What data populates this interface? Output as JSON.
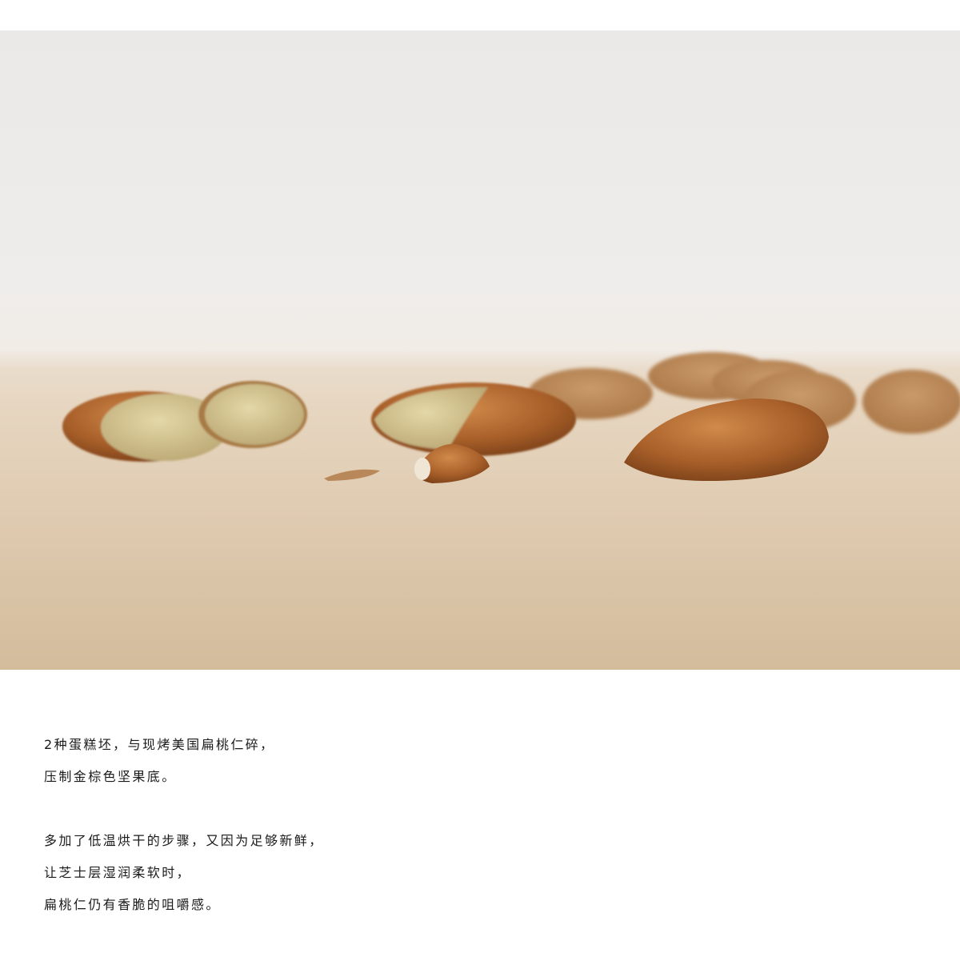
{
  "photo": {
    "subject": "almonds-on-wood"
  },
  "description": {
    "paragraph1": [
      "2种蛋糕坯，与现烤美国扁桃仁碎，",
      "压制金棕色坚果底。"
    ],
    "paragraph2": [
      "多加了低温烘干的步骤，又因为足够新鲜，",
      "让芝士层湿润柔软时，",
      "扁桃仁仍有香脆的咀嚼感。"
    ]
  }
}
